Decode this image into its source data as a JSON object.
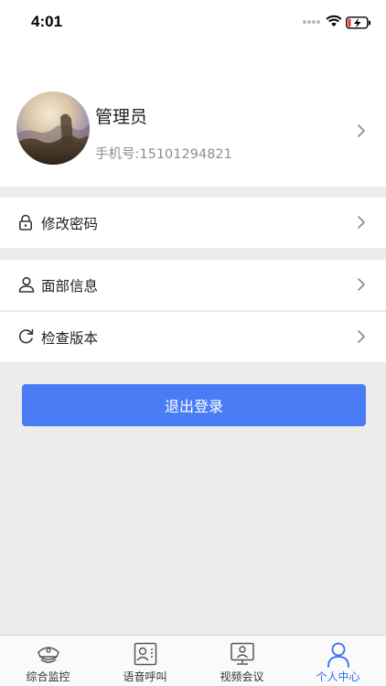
{
  "status_bar": {
    "time": "4:01"
  },
  "profile": {
    "name": "管理员",
    "phone": "手机号:15101294821"
  },
  "menu": {
    "change_password": "修改密码",
    "face_info": "面部信息",
    "check_version": "检查版本"
  },
  "logout_label": "退出登录",
  "tabs": [
    {
      "label": "综合监控",
      "icon": "police-cap-icon"
    },
    {
      "label": "语音呼叫",
      "icon": "voice-call-icon"
    },
    {
      "label": "视频会议",
      "icon": "video-conference-icon"
    },
    {
      "label": "个人中心",
      "icon": "person-icon",
      "active": true
    }
  ],
  "colors": {
    "accent": "#4a7cf6",
    "active_tab": "#2e6ff0",
    "background": "#ececec"
  }
}
